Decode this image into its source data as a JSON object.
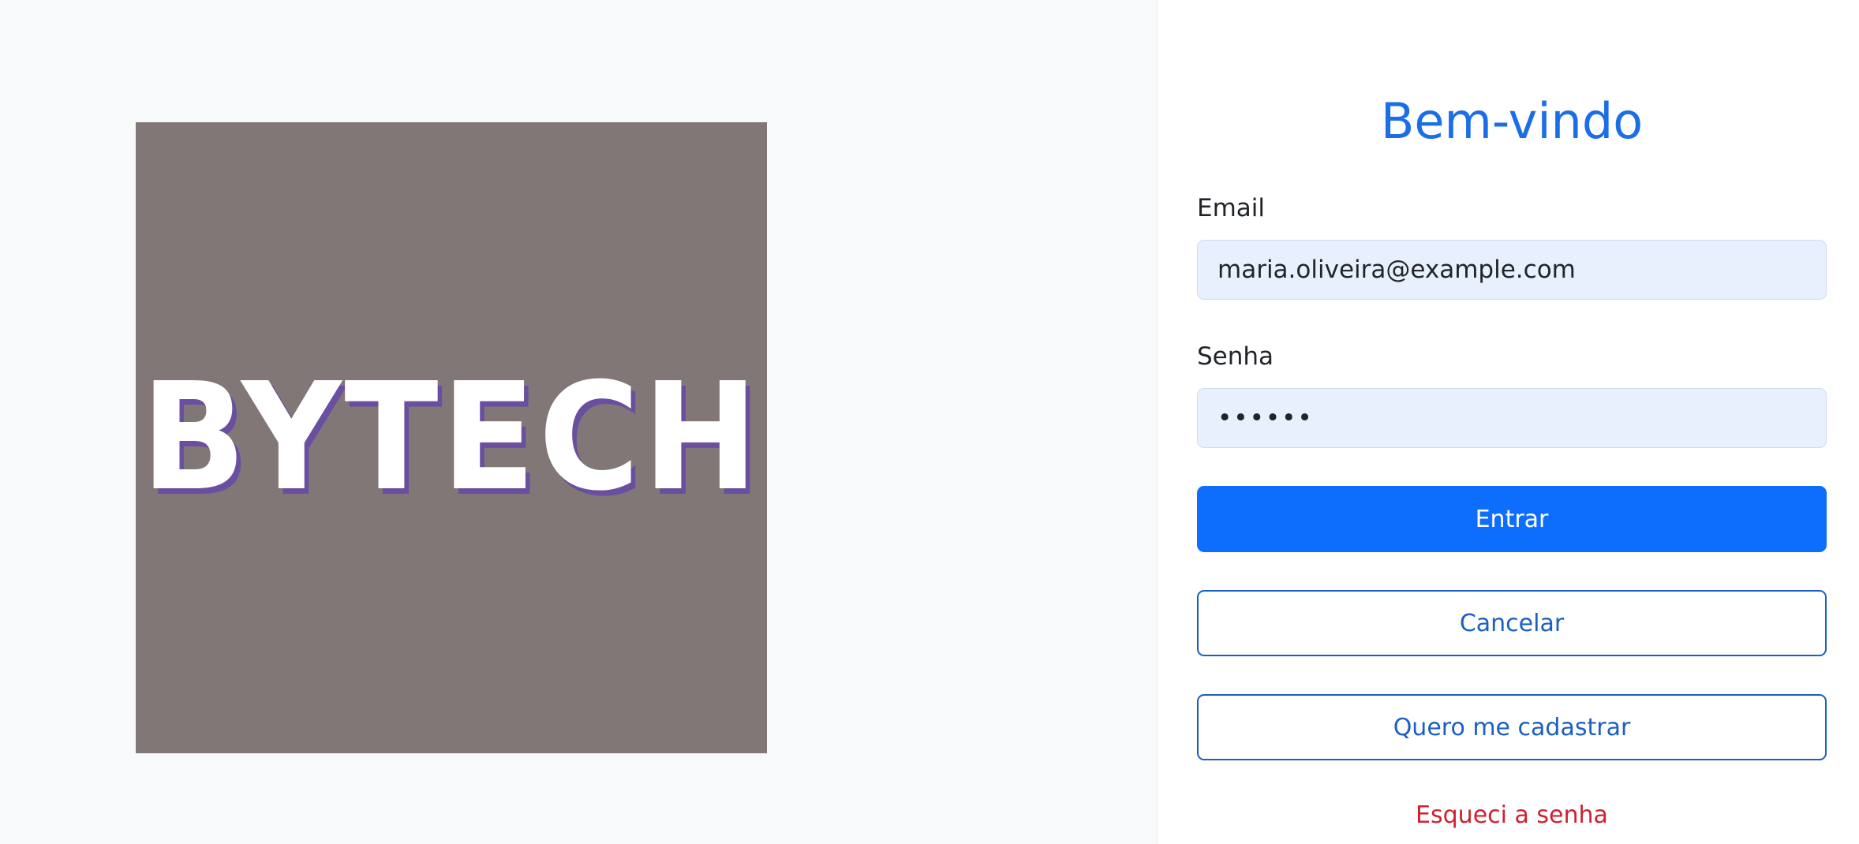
{
  "brand": {
    "logo_text": "BYTECH"
  },
  "login": {
    "title": "Bem-vindo",
    "email_label": "Email",
    "email_value": "maria.oliveira@example.com",
    "password_label": "Senha",
    "password_value": "••••••",
    "submit_label": "Entrar",
    "cancel_label": "Cancelar",
    "signup_label": "Quero me cadastrar",
    "forgot_label": "Esqueci a senha"
  },
  "colors": {
    "accent": "#0d6efd",
    "title": "#1a6ee6",
    "danger": "#d21f2f",
    "logo_background": "#807776"
  }
}
